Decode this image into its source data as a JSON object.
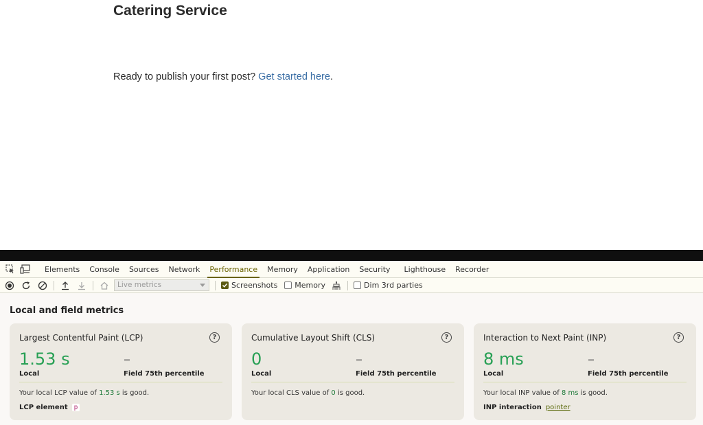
{
  "page": {
    "site_title": "Catering Service",
    "intro_text": "Ready to publish your first post?",
    "intro_link": "Get started here",
    "intro_end": "."
  },
  "devtools": {
    "tabs": [
      "Elements",
      "Console",
      "Sources",
      "Network",
      "Performance",
      "Memory",
      "Application",
      "Security",
      "Lighthouse",
      "Recorder"
    ],
    "active_tab": "Performance",
    "toolbar": {
      "select_value": "Live metrics",
      "screenshots_label": "Screenshots",
      "screenshots_checked": true,
      "memory_label": "Memory",
      "memory_checked": false,
      "dim_label": "Dim 3rd parties",
      "dim_checked": false
    },
    "section_title": "Local and field metrics",
    "colors": {
      "good": "#28a055",
      "accent": "#6a6300"
    },
    "cards": [
      {
        "title": "Largest Contentful Paint (LCP)",
        "local_value": "1.53 s",
        "field_value": "–",
        "local_label": "Local",
        "field_label": "Field 75th percentile",
        "desc_pre": "Your local LCP value of ",
        "desc_value": "1.53 s",
        "desc_post": " is good.",
        "extra_label": "LCP element",
        "extra_value": "p"
      },
      {
        "title": "Cumulative Layout Shift (CLS)",
        "local_value": "0",
        "field_value": "–",
        "local_label": "Local",
        "field_label": "Field 75th percentile",
        "desc_pre": "Your local CLS value of ",
        "desc_value": "0",
        "desc_post": " is good."
      },
      {
        "title": "Interaction to Next Paint (INP)",
        "local_value": "8 ms",
        "field_value": "–",
        "local_label": "Local",
        "field_label": "Field 75th percentile",
        "desc_pre": "Your local INP value of ",
        "desc_value": "8 ms",
        "desc_post": " is good.",
        "extra_label": "INP interaction",
        "extra_value": "pointer"
      }
    ]
  }
}
